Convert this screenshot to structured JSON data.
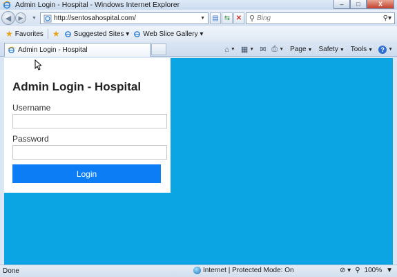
{
  "window": {
    "title": "Admin Login - Hospital - Windows Internet Explorer",
    "buttons": [
      "–",
      "□",
      "X"
    ]
  },
  "address_bar": {
    "url": "http://sentosahospital.com/",
    "search_placeholder": "Bing"
  },
  "favorites_bar": {
    "favorites_label": "Favorites",
    "links": [
      "Suggested Sites ▾",
      "Web Slice Gallery ▾"
    ]
  },
  "tabs": {
    "active_tab": "Admin Login - Hospital"
  },
  "command_bar": {
    "page": "Page",
    "safety": "Safety",
    "tools": "Tools",
    "help": "?"
  },
  "login": {
    "heading": "Admin Login - Hospital",
    "username_label": "Username",
    "password_label": "Password",
    "username_value": "",
    "password_value": "",
    "button": "Login"
  },
  "status_bar": {
    "status": "Done",
    "zone": "Internet | Protected Mode: On",
    "zoom": "100%"
  },
  "colors": {
    "page_background": "#0ba5e3",
    "login_button": "#0d7df5"
  },
  "icons": [
    "ie-logo-icon",
    "back-icon",
    "forward-icon",
    "page-icon",
    "refresh-icon",
    "compatibility-icon",
    "stop-icon",
    "search-icon",
    "favorites-star-icon",
    "add-favorite-icon",
    "home-icon",
    "feeds-icon",
    "mail-icon",
    "print-icon",
    "help-icon",
    "globe-icon",
    "cursor-icon"
  ]
}
